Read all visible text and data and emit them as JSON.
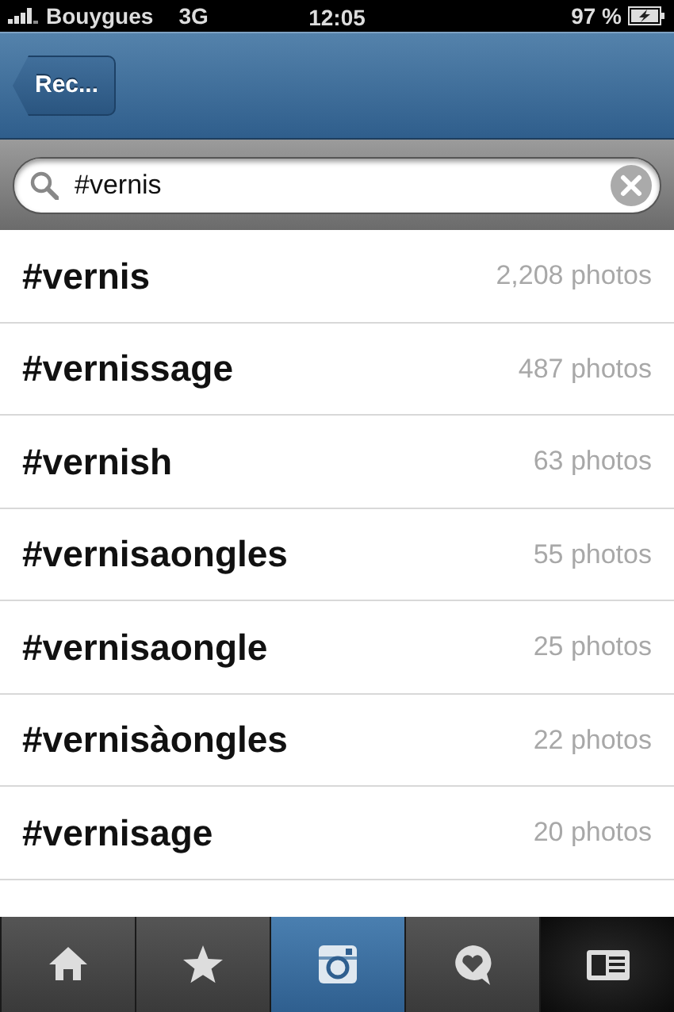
{
  "status_bar": {
    "carrier": "Bouygues",
    "network": "3G",
    "time": "12:05",
    "battery": "97 %"
  },
  "nav_bar": {
    "back_button": "Rec..."
  },
  "search": {
    "value": "#vernis"
  },
  "results": [
    {
      "tag": "#vernis",
      "count": "2,208 photos"
    },
    {
      "tag": "#vernissage",
      "count": "487 photos"
    },
    {
      "tag": "#vernish",
      "count": "63 photos"
    },
    {
      "tag": "#vernisaongles",
      "count": "55 photos"
    },
    {
      "tag": "#vernisaongle",
      "count": "25 photos"
    },
    {
      "tag": "#vernisàongles",
      "count": "22 photos"
    },
    {
      "tag": "#vernisage",
      "count": "20 photos"
    }
  ],
  "tab_bar": [
    {
      "kind": "home",
      "selected": false
    },
    {
      "kind": "star",
      "selected": false
    },
    {
      "kind": "camera",
      "selected": false
    },
    {
      "kind": "heart",
      "selected": false
    },
    {
      "kind": "profile",
      "selected": true
    }
  ]
}
